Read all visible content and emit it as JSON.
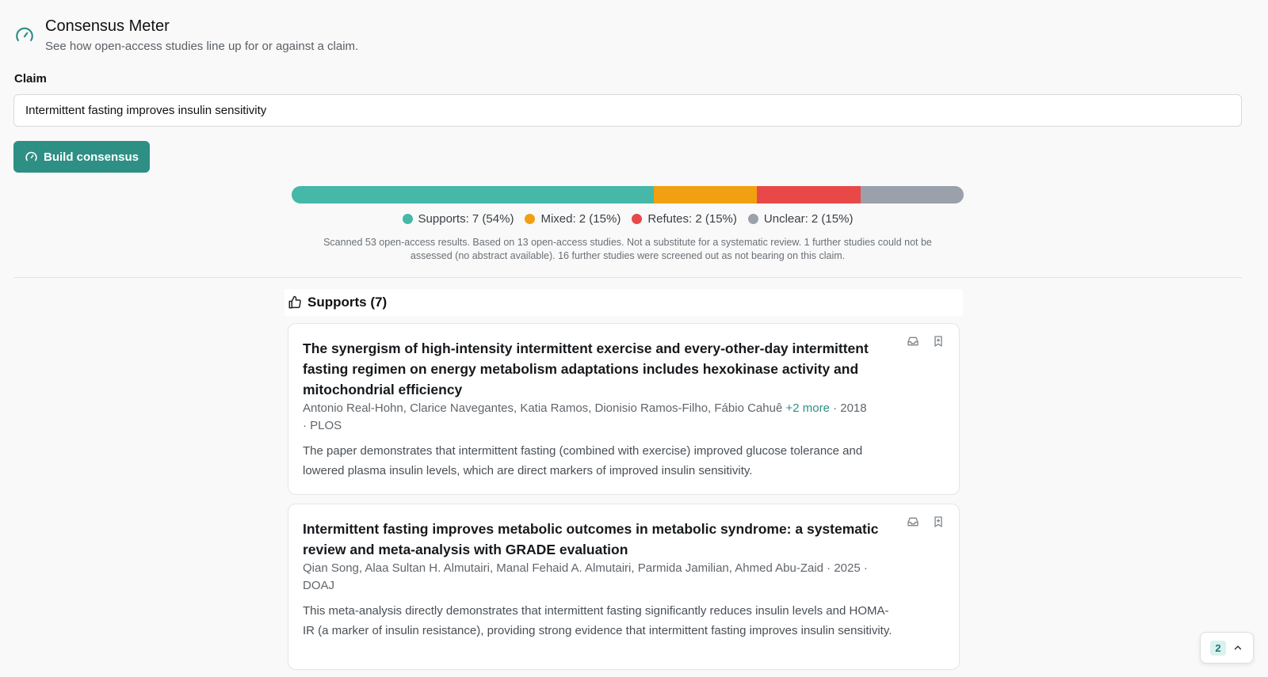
{
  "header": {
    "title": "Consensus Meter",
    "subtitle": "See how open-access studies line up for or against a claim.",
    "icon": "gauge-icon"
  },
  "claim": {
    "label": "Claim",
    "value": "Intermittent fasting improves insulin sensitivity"
  },
  "build_button": {
    "label": "Build consensus",
    "icon": "gauge-icon"
  },
  "meter": {
    "segments": [
      {
        "name": "Supports",
        "count": 7,
        "percent": 54,
        "color": "#45b8a8"
      },
      {
        "name": "Mixed",
        "count": 2,
        "percent": 15,
        "color": "#f0a011"
      },
      {
        "name": "Refutes",
        "count": 2,
        "percent": 15,
        "color": "#e84848"
      },
      {
        "name": "Unclear",
        "count": 2,
        "percent": 15,
        "color": "#9ba1ab"
      }
    ],
    "legend": [
      "Supports: 7 (54%)",
      "Mixed: 2 (15%)",
      "Refutes: 2 (15%)",
      "Unclear: 2 (15%)"
    ],
    "note": "Scanned 53 open-access results. Based on 13 open-access studies. Not a substitute for a systematic review. 1 further studies could not be assessed (no abstract available). 16 further studies were screened out as not bearing on this claim."
  },
  "section": {
    "title": "Supports (7)",
    "icon": "thumbs-up-icon"
  },
  "cards": [
    {
      "title": "The synergism of high-intensity intermittent exercise and every-other-day intermittent fasting regimen on energy metabolism adaptations includes hexokinase activity and mitochondrial efficiency",
      "authors": "Antonio Real-Hohn, Clarice Navegantes, Katia Ramos, Dionisio Ramos-Filho, Fábio Cahuê",
      "more": "+2 more",
      "year_source": " · 2018 · PLOS",
      "abstract": "The paper demonstrates that intermittent fasting (combined with exercise) improved glucose tolerance and lowered plasma insulin levels, which are direct markers of improved insulin sensitivity."
    },
    {
      "title": "Intermittent fasting improves metabolic outcomes in metabolic syndrome: a systematic review and meta-analysis with GRADE evaluation",
      "authors": "Qian Song, Alaa Sultan H. Almutairi, Manal Fehaid A. Almutairi, Parmida Jamilian, Ahmed Abu-Zaid",
      "more": "",
      "year_source": " · 2025 · DOAJ",
      "abstract": "This meta-analysis directly demonstrates that intermittent fasting significantly reduces insulin levels and HOMA-IR (a marker of insulin resistance), providing strong evidence that intermittent fasting improves insulin sensitivity."
    }
  ],
  "float_button": {
    "badge": "2",
    "icon": "chevron-up-icon"
  }
}
